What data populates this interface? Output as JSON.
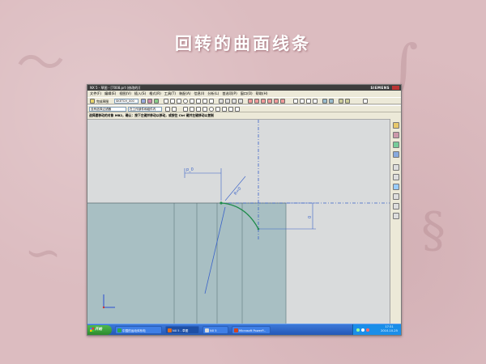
{
  "slide": {
    "title": "回转的曲面线条"
  },
  "window": {
    "title": "NX 5 - 草图 - [7008.prt (修改的)]",
    "brand": "SIEMENS",
    "menu": [
      "文件(F)",
      "编辑(E)",
      "视图(V)",
      "插入(S)",
      "格式(R)",
      "工具(T)",
      "装配(A)",
      "信息(I)",
      "分析(L)",
      "首选项(P)",
      "窗口(O)",
      "帮助(H)"
    ],
    "toolbar": {
      "finish_label": "完成草图",
      "sketch_name": "SKETCH_000",
      "filter_value": "没有选择过滤器",
      "scope_value": "在工作部件和组件内"
    },
    "cue_line": "选择要移动的对象 MB2，确认：按下左键并移动以移动，或按住 Ctrl 键并左键移动以复制"
  },
  "sketch": {
    "dim_horizontal": "p_0",
    "dim_radius": "R=0",
    "dim_vertical": "0"
  },
  "taskbar": {
    "start_label": "开始",
    "tasks": [
      {
        "label": "中国的运动体系电",
        "color": "#2fa84f",
        "active": false
      },
      {
        "label": "NX 5 - 草图",
        "color": "#e06a1a",
        "active": true
      },
      {
        "label": "NX 5",
        "color": "#d9d9d9",
        "active": false
      },
      {
        "label": "Microsoft PowerP...",
        "color": "#d2431e",
        "active": false
      }
    ],
    "clock_time": "17:31",
    "clock_date": "2010-10-25"
  },
  "colors": {
    "solid_face": "#a8bfc3",
    "dimension": "#3a63c8",
    "curve": "#1e8c4a"
  }
}
